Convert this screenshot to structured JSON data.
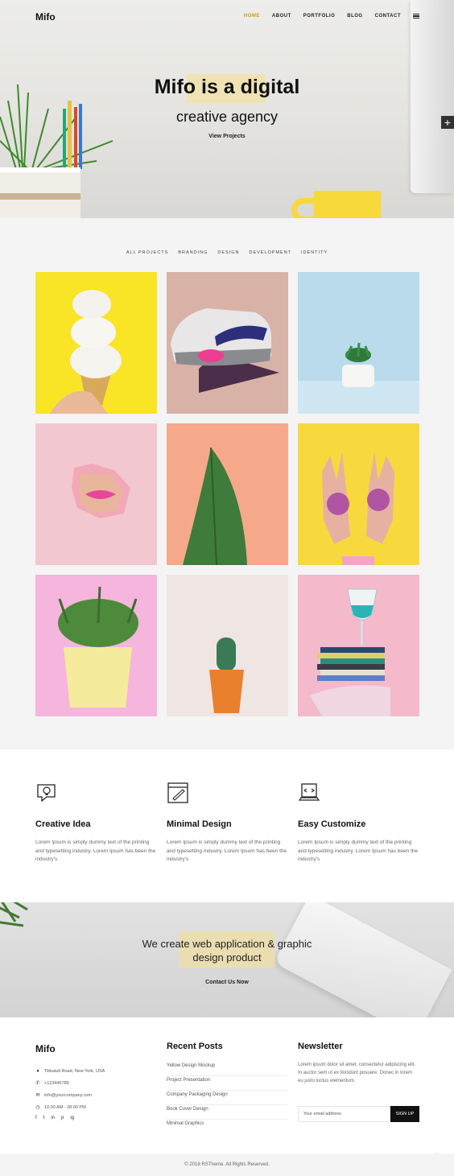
{
  "brand": "Mifo",
  "nav": {
    "items": [
      "HOME",
      "ABOUT",
      "PORTFOLIO",
      "BLOG",
      "CONTACT"
    ],
    "active": "HOME",
    "menu_icon": "hamburger-icon"
  },
  "hero": {
    "title": "Mifo is a digital",
    "subtitle": "creative agency",
    "link": "View Projects",
    "side_button": "+"
  },
  "portfolio": {
    "filters": [
      "ALL PROJECTS",
      "BRANDING",
      "DESIGN",
      "DEVELOPMENT",
      "IDENTITY"
    ],
    "active_filter": "ALL PROJECTS",
    "tiles": [
      {
        "subject": "ice cream cone",
        "bg": "#f9e426"
      },
      {
        "subject": "sneaker on hand",
        "bg": "#d8b2a6"
      },
      {
        "subject": "small plant pot",
        "bg": "#b9dbec"
      },
      {
        "subject": "lips through paper",
        "bg": "#f3c7d0"
      },
      {
        "subject": "green leaf",
        "bg": "#f5a98a"
      },
      {
        "subject": "glitter hands",
        "bg": "#f7d93e"
      },
      {
        "subject": "yellow plant pot",
        "bg": "#f6b5dc"
      },
      {
        "subject": "cactus",
        "bg": "#efe5e2"
      },
      {
        "subject": "glass on books",
        "bg": "#f4b9cb"
      }
    ]
  },
  "features": [
    {
      "title": "Creative Idea",
      "text": "Lorem Ipsum is simply dummy text of the printing and typesetting industry. Lorem Ipsum has been the industry's",
      "icon": "idea-chat-icon"
    },
    {
      "title": "Minimal Design",
      "text": "Lorem Ipsum is simply dummy text of the printing and typesetting industry. Lorem Ipsum has been the industry's",
      "icon": "design-window-icon"
    },
    {
      "title": "Easy Customize",
      "text": "Lorem Ipsum is simply dummy text of the printing and typesetting industry. Lorem Ipsum has been the industry's",
      "icon": "code-laptop-icon"
    }
  ],
  "cta": {
    "line1": "We create web application & graphic",
    "line2": "design product",
    "link": "Contact Us Now"
  },
  "footer": {
    "brand": "Mifo",
    "contact": [
      {
        "icon": "location-icon",
        "text": "Tikkatuli Road, New York, USA"
      },
      {
        "icon": "phone-icon",
        "text": "+123445789"
      },
      {
        "icon": "mail-icon",
        "text": "info@yourcompany.com"
      },
      {
        "icon": "clock-icon",
        "text": "10.00 AM - 08.00 PM"
      }
    ],
    "socials": [
      "f",
      "t",
      "in",
      "p",
      "ig"
    ],
    "recent_posts_title": "Recent Posts",
    "recent_posts": [
      "Yellow Design Mockup",
      "Project Presentation",
      "Company Packaging Design",
      "Book Cover Design",
      "Minimal Graphics"
    ],
    "newsletter_title": "Newsletter",
    "newsletter_text": "Lorem ipsum dolor sit amet, consectetur adipiscing elit. In auctor sem ut ex tincidunt posuere. Donec in lorem eu justo luctus elementum.",
    "email_placeholder": "Your email address",
    "signup": "SIGN UP",
    "scroll_top": "↑"
  },
  "copyright": "© 2018 RSTheme. All Rights Reserved."
}
